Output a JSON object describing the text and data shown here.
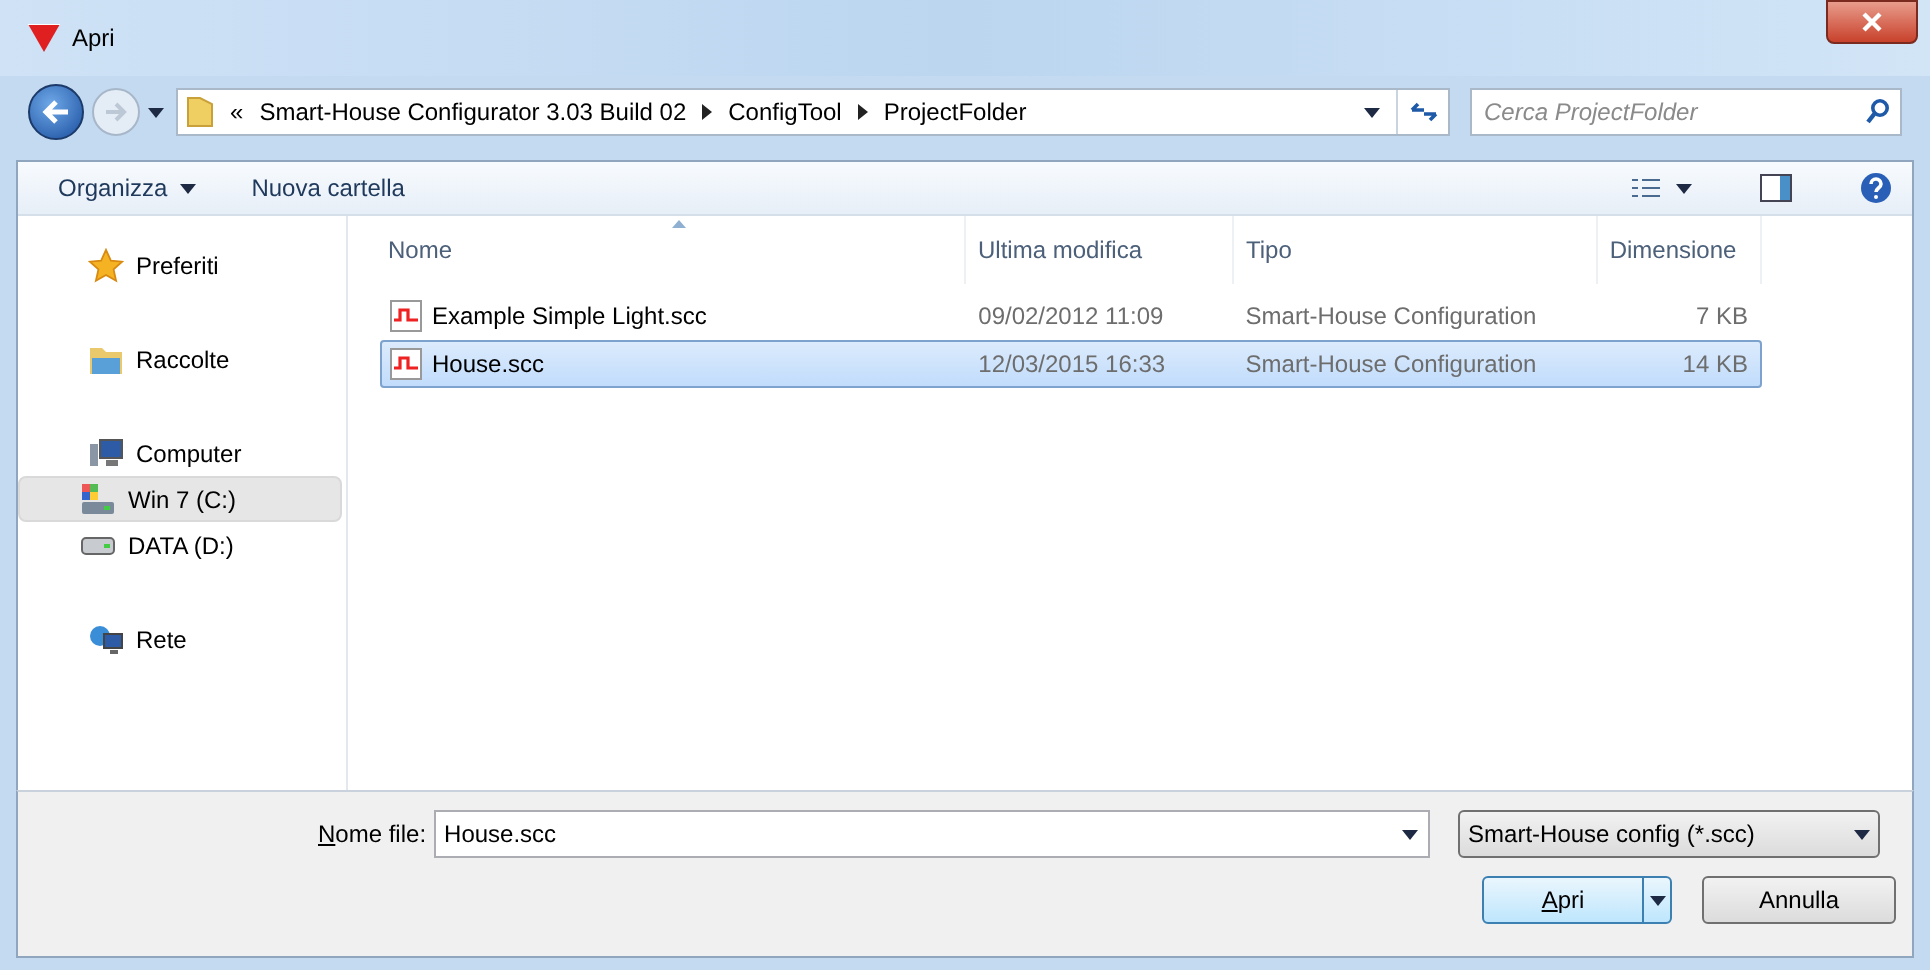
{
  "window": {
    "title": "Apri"
  },
  "address": {
    "overflow": "«",
    "crumbs": [
      "Smart-House Configurator 3.03 Build 02",
      "ConfigTool",
      "ProjectFolder"
    ]
  },
  "search": {
    "placeholder": "Cerca ProjectFolder"
  },
  "toolbar": {
    "buttons": [
      {
        "label": "Organizza",
        "dropdown": true
      },
      {
        "label": "Nuova cartella",
        "dropdown": false
      }
    ]
  },
  "sidebar": {
    "items": [
      {
        "label": "Preferiti",
        "kind": "star",
        "selected": false
      },
      {
        "label": "Raccolte",
        "kind": "library",
        "selected": false
      },
      {
        "label": "Computer",
        "kind": "computer",
        "selected": false,
        "children": [
          {
            "label": "Win 7 (C:)",
            "kind": "windrive",
            "selected": true
          },
          {
            "label": "DATA (D:)",
            "kind": "drive",
            "selected": false
          }
        ]
      },
      {
        "label": "Rete",
        "kind": "network",
        "selected": false
      }
    ]
  },
  "table": {
    "columns": [
      "Nome",
      "Ultima modifica",
      "Tipo",
      "Dimensione"
    ],
    "rows": [
      {
        "cells": [
          "Example Simple Light.scc",
          "09/02/2012 11:09",
          "Smart-House Configuration",
          "7 KB"
        ],
        "selected": false
      },
      {
        "cells": [
          "House.scc",
          "12/03/2015 16:33",
          "Smart-House Configuration",
          "14 KB"
        ],
        "selected": true
      }
    ]
  },
  "footer": {
    "filename_label": "Nome file:",
    "filename": "House.scc",
    "filter": "Smart-House config (*.scc)",
    "buttons": [
      "Apri",
      "Annulla"
    ]
  }
}
